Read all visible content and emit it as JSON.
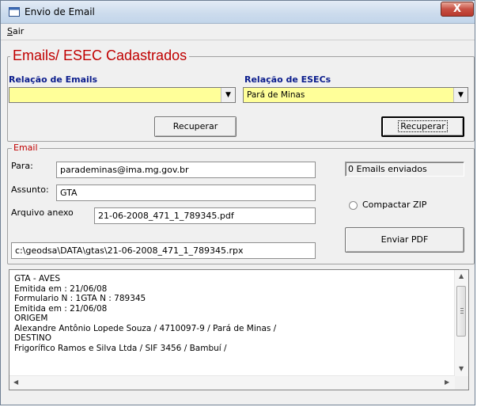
{
  "window": {
    "title": "Envio de Email",
    "close_label": "X"
  },
  "menu": {
    "sair_first": "S",
    "sair_rest": "air"
  },
  "cadastrados": {
    "title": "Emails/ ESEC Cadastrados",
    "emails_label": "Relação de Emails",
    "emails_value": "",
    "esecs_label": "Relação de ESECs",
    "esecs_value": "Pará de Minas",
    "recuperar_left": "Recuperar",
    "recuperar_right": "Recuperar"
  },
  "email": {
    "title": "Email",
    "para_label": "Para:",
    "para_value": "parademinas@ima.mg.gov.br",
    "assunto_label": "Assunto:",
    "assunto_value": "GTA",
    "anexo_label": "Arquivo anexo",
    "anexo_value": "21-06-2008_471_1_789345.pdf",
    "path_value": "c:\\geodsa\\DATA\\gtas\\21-06-2008_471_1_789345.rpx",
    "counter": "0 Emails enviados",
    "zip_label": "Compactar ZIP",
    "zip_selected": false,
    "send_button": "Enviar PDF"
  },
  "memo": {
    "lines": [
      "GTA - AVES",
      "Emitida em : 21/06/08",
      "Formulario N : 1GTA N : 789345",
      "Emitida em : 21/06/08",
      "ORIGEM",
      "Alexandre Antônio Lopede Souza / 4710097-9 / Pará de Minas /",
      "DESTINO",
      "Frigorífico Ramos e Silva Ltda / SIF 3456 / Bambuí /"
    ]
  },
  "icons": {
    "app": "app-window-icon",
    "combo_arrow": "chevron-down-icon",
    "scroll_up": "scroll-up-arrow-icon",
    "scroll_down": "scroll-down-arrow-icon",
    "scroll_left": "scroll-left-arrow-icon",
    "scroll_right": "scroll-right-arrow-icon"
  },
  "colors": {
    "highlight_field": "#ffff99",
    "group_title": "#c00000",
    "label_blue": "#0a1c8c"
  }
}
